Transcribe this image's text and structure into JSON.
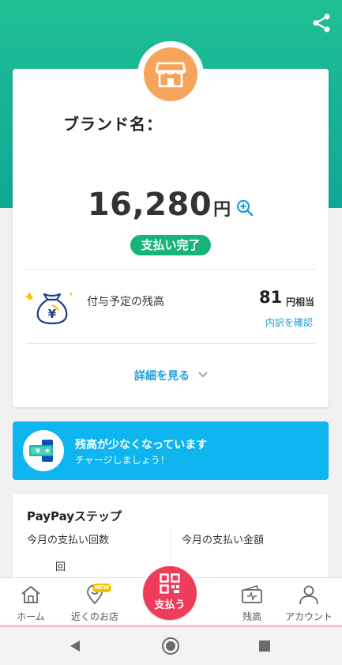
{
  "receipt": {
    "brand_label": "ブランド名：",
    "amount": "16,280",
    "amount_unit": "円",
    "status": "支払い完了",
    "points_label": "付与予定の残高",
    "points_value": "81",
    "points_unit": "円相当",
    "breakdown_link": "内訳を確認",
    "details_link": "詳細を見る"
  },
  "banner": {
    "title": "残高が少なくなっています",
    "subtitle": "チャージしましょう！"
  },
  "paypay_step": {
    "title": "PayPayステップ",
    "left_label": "今月の支払い回数",
    "right_label": "今月の支払い金額",
    "count_unit": "回"
  },
  "tabs": {
    "home": "ホーム",
    "nearby": "近くのお店",
    "nearby_badge": "NEW",
    "pay": "支払う",
    "balance": "残高",
    "account": "アカウント"
  },
  "colors": {
    "hero": "#1fbf95",
    "status_green": "#16b47a",
    "link_blue": "#1a9fd6",
    "banner_blue": "#0eb5ee",
    "pay_red": "#ed3d5a",
    "shop_orange": "#f6a35c"
  },
  "icons": [
    "share-icon",
    "shop-icon",
    "zoom-icon",
    "money-bag-icon",
    "chevron-down-icon",
    "charge-card-icon",
    "home-icon",
    "location-pin-icon",
    "qr-code-icon",
    "wallet-icon",
    "person-icon",
    "back-icon",
    "home-circle-icon",
    "recents-icon"
  ]
}
